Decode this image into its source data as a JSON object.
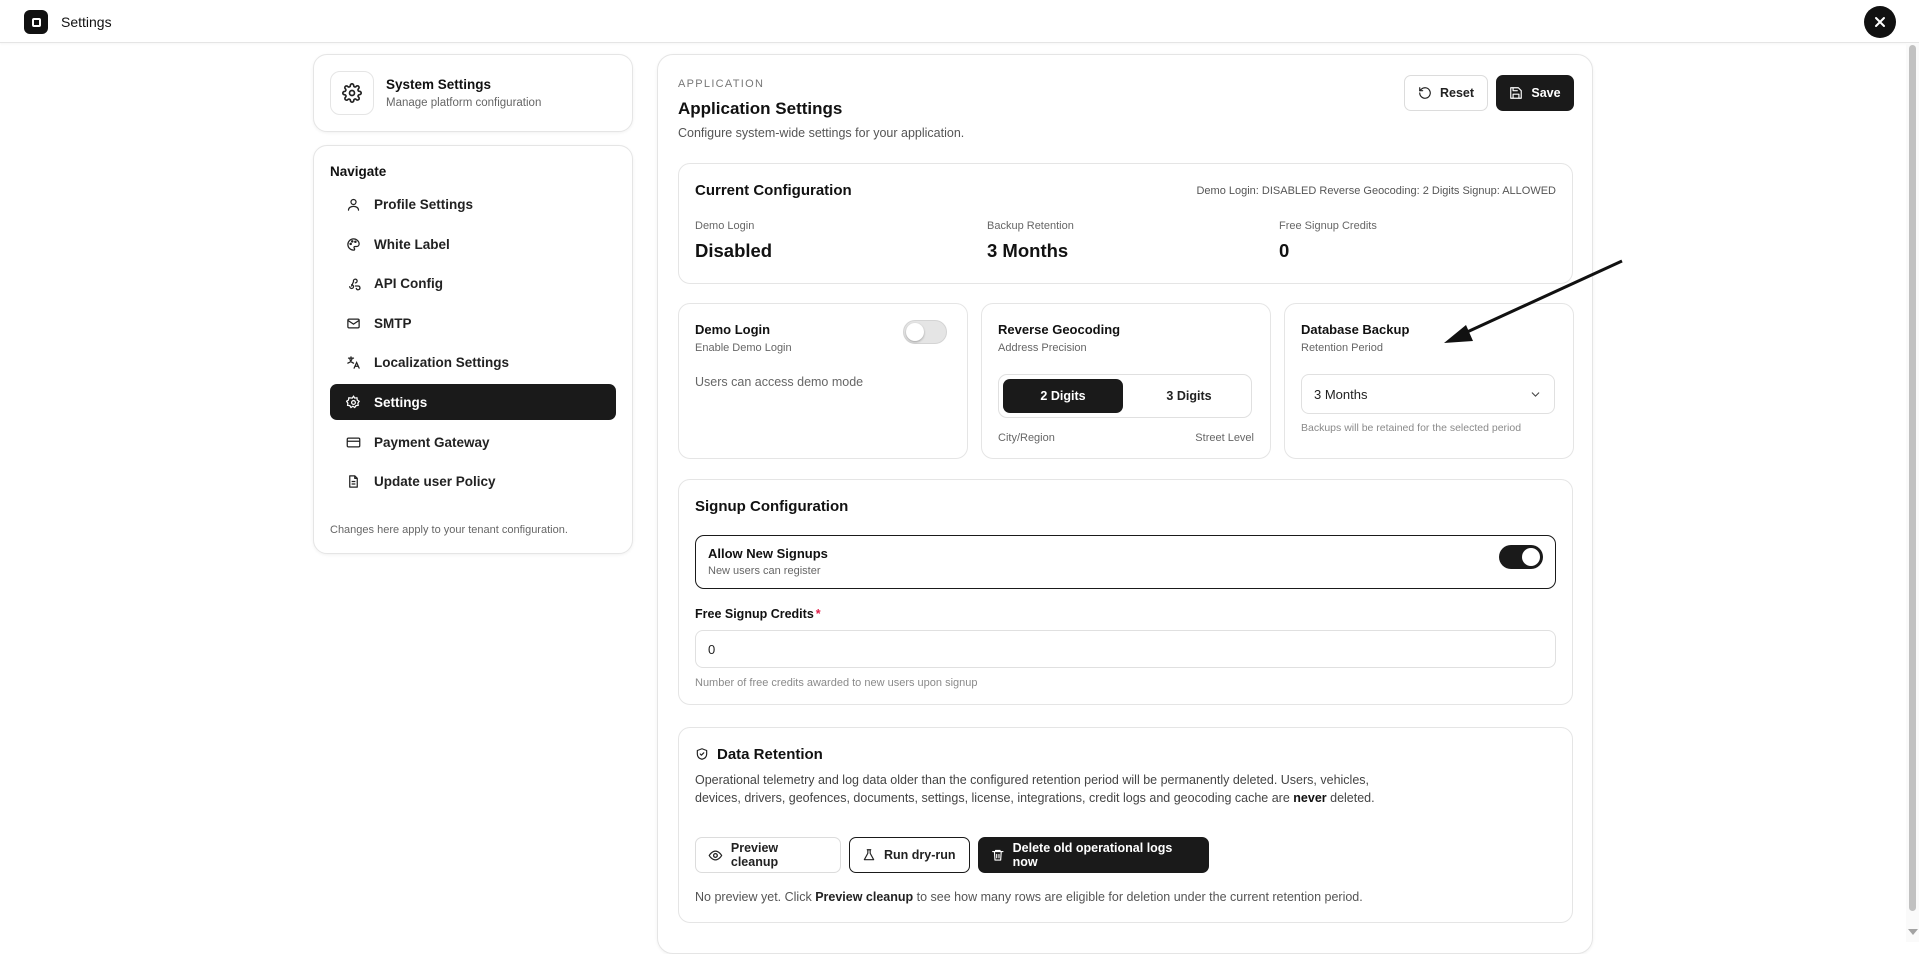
{
  "topbar": {
    "title": "Settings"
  },
  "system_card": {
    "title": "System Settings",
    "subtitle": "Manage platform configuration",
    "icon": "gear-icon"
  },
  "sidebar": {
    "heading": "Navigate",
    "items": [
      {
        "label": "Profile Settings",
        "icon": "user-icon",
        "active": false
      },
      {
        "label": "White Label",
        "icon": "palette-icon",
        "active": false
      },
      {
        "label": "API Config",
        "icon": "webhook-icon",
        "active": false
      },
      {
        "label": "SMTP",
        "icon": "mail-icon",
        "active": false
      },
      {
        "label": "Localization Settings",
        "icon": "translate-icon",
        "active": false
      },
      {
        "label": "Settings",
        "icon": "gear-icon",
        "active": true
      },
      {
        "label": "Payment Gateway",
        "icon": "credit-card-icon",
        "active": false
      },
      {
        "label": "Update user Policy",
        "icon": "document-icon",
        "active": false
      }
    ],
    "footer": "Changes here apply to your tenant configuration."
  },
  "header": {
    "eyebrow": "APPLICATION",
    "title": "Application Settings",
    "subtitle": "Configure system-wide settings for your application.",
    "reset_label": "Reset",
    "save_label": "Save"
  },
  "current_config": {
    "title": "Current Configuration",
    "summary": "Demo Login: DISABLED Reverse Geocoding: 2 Digits Signup: ALLOWED",
    "stats": [
      {
        "label": "Demo Login",
        "value": "Disabled"
      },
      {
        "label": "Backup Retention",
        "value": "3 Months"
      },
      {
        "label": "Free Signup Credits",
        "value": "0"
      }
    ]
  },
  "demo_login": {
    "title": "Demo Login",
    "subtitle": "Enable Demo Login",
    "note": "Users can access demo mode",
    "enabled": false
  },
  "reverse_geocoding": {
    "title": "Reverse Geocoding",
    "subtitle": "Address Precision",
    "options": [
      "2 Digits",
      "3 Digits"
    ],
    "selected": "2 Digits",
    "left_hint": "City/Region",
    "right_hint": "Street Level"
  },
  "database_backup": {
    "title": "Database Backup",
    "subtitle": "Retention Period",
    "selected": "3 Months",
    "note": "Backups will be retained for the selected period"
  },
  "signup": {
    "title": "Signup Configuration",
    "allow_title": "Allow New Signups",
    "allow_sub": "New users can register",
    "allow_enabled": true,
    "credits_label": "Free Signup Credits",
    "required_mark": "*",
    "credits_value": "0",
    "credits_note": "Number of free credits awarded to new users upon signup"
  },
  "retention": {
    "title": "Data Retention",
    "desc_part1": "Operational telemetry and log data older than the configured retention period will be permanently deleted. Users, vehicles, devices, drivers, geofences, documents, settings, license, integrations, credit logs and geocoding cache are",
    "desc_bold": "never",
    "desc_part2": "deleted.",
    "preview_label": "Preview cleanup",
    "dry_run_label": "Run dry-run",
    "delete_label": "Delete old operational logs now",
    "foot_part1": "No preview yet. Click",
    "foot_bold": "Preview cleanup",
    "foot_part2": "to see how many rows are eligible for deletion under the current retention period."
  },
  "colors": {
    "primary": "#1a1a1a",
    "required": "#e11d48",
    "border": "#e5e5e5"
  }
}
